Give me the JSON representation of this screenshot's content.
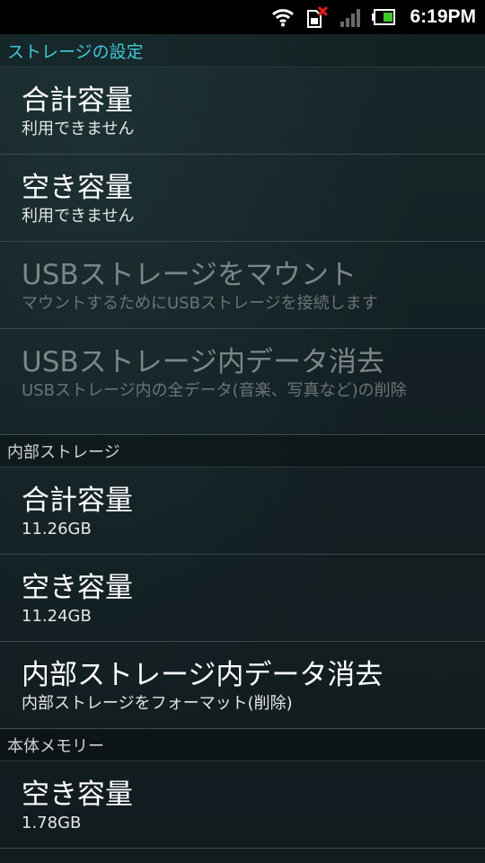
{
  "status_bar": {
    "time": "6:19PM",
    "icons": [
      "wifi-icon",
      "sim-error-icon",
      "signal-icon",
      "battery-icon"
    ]
  },
  "screen": {
    "title": "ストレージの設定",
    "title_color": "#3ec9d6"
  },
  "general": {
    "items": [
      {
        "title": "合計容量",
        "subtitle": "利用できません",
        "enabled": true
      },
      {
        "title": "空き容量",
        "subtitle": "利用できません",
        "enabled": true
      },
      {
        "title": "USBストレージをマウント",
        "subtitle": "マウントするためにUSBストレージを接続します",
        "enabled": false
      },
      {
        "title": "USBストレージ内データ消去",
        "subtitle": "USBストレージ内の全データ(音楽、写真など)の削除",
        "enabled": false
      }
    ]
  },
  "internal": {
    "header": "内部ストレージ",
    "items": [
      {
        "title": "合計容量",
        "subtitle": "11.26GB",
        "enabled": true
      },
      {
        "title": "空き容量",
        "subtitle": "11.24GB",
        "enabled": true
      },
      {
        "title": "内部ストレージ内データ消去",
        "subtitle": "内部ストレージをフォーマット(削除)",
        "enabled": true
      }
    ]
  },
  "device_memory": {
    "header": "本体メモリー",
    "items": [
      {
        "title": "空き容量",
        "subtitle": "1.78GB",
        "enabled": true
      }
    ]
  }
}
